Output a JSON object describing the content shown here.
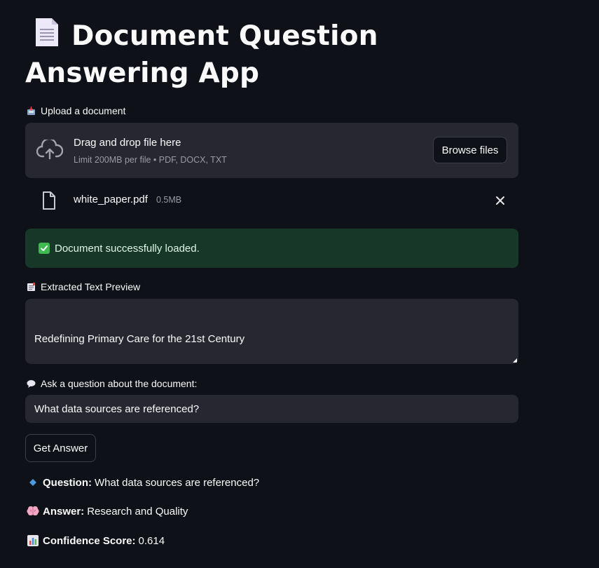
{
  "page": {
    "title_line": "Document Question Answering App",
    "title_icon": "page-document-icon"
  },
  "uploader": {
    "label": "Upload a document",
    "label_icon": "inbox-tray-icon",
    "drop_text": "Drag and drop file here",
    "limit_text": "Limit 200MB per file • PDF, DOCX, TXT",
    "browse_label": "Browse files",
    "file": {
      "name": "white_paper.pdf",
      "size": "0.5MB"
    }
  },
  "status": {
    "message": "Document successfully loaded.",
    "icon": "check-mark-icon",
    "color": "#173828"
  },
  "preview": {
    "label": "Extracted Text Preview",
    "label_icon": "bookmark-tabs-icon",
    "text": "Redefining Primary Care for the 21st Century"
  },
  "question": {
    "label": "Ask a question about the document:",
    "label_icon": "speech-balloon-icon",
    "value": "What data sources are referenced?"
  },
  "actions": {
    "get_answer_label": "Get Answer"
  },
  "results": {
    "question_label": "Question:",
    "question_value": "What data sources are referenced?",
    "answer_label": "Answer:",
    "answer_value": "Research and Quality",
    "confidence_label": "Confidence Score:",
    "confidence_value": "0.614"
  },
  "colors": {
    "background": "#0e1117",
    "widget": "#262730",
    "success": "#173828"
  }
}
